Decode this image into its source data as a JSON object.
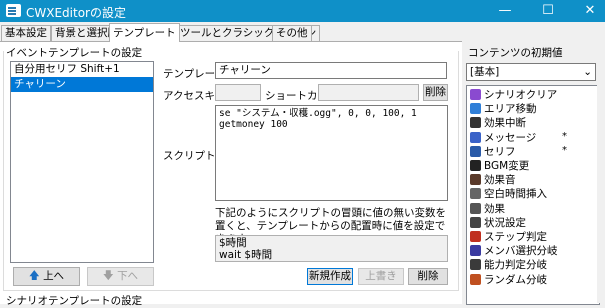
{
  "window": {
    "title": "CWXEditorの設定",
    "minimize": "—",
    "maximize": "☐",
    "close": "✕"
  },
  "tabs": [
    "基本設定",
    "背景と選択肢",
    "テンプレート",
    "外部ツールとクラシックエンジン",
    "その他"
  ],
  "event_templates": {
    "group_title": "イベントテンプレートの設定",
    "items": [
      "自分用セリフ Shift+1",
      "チャリーン"
    ],
    "selected_index": 1,
    "up_button": "上へ",
    "down_button": "下へ"
  },
  "form": {
    "name_label": "テンプレート名",
    "name_value": "チャリーン",
    "accesskey_label": "アクセスキー",
    "accesskey_value": "",
    "shortcut_label": "ショートカット",
    "shortcut_value": "",
    "delete_shortcut": "削除",
    "script_label": "スクリプト",
    "script_lines": [
      "se \"システム・収穫.ogg\", 0, 0, 100, 1",
      "getmoney 100"
    ],
    "help_text": "下記のようにスクリプトの冒頭に値の無い変数を置くと、テンプレートからの配置時に値を設定できます。",
    "example_lines": [
      "$時間",
      "wait $時間"
    ],
    "new_button": "新規作成",
    "overwrite_button": "上書き",
    "delete_button": "削除"
  },
  "scenario_group_title": "シナリオテンプレートの設定",
  "content_panel": {
    "title": "コンテンツの初期値",
    "dropdown_value": "[基本]",
    "items": [
      {
        "label": "シナリオクリア",
        "icon": "scenario-clear-icon",
        "color": "#8a4ad0",
        "star": false
      },
      {
        "label": "エリア移動",
        "icon": "area-move-icon",
        "color": "#2f7fd8",
        "star": false
      },
      {
        "label": "効果中断",
        "icon": "effect-break-icon",
        "color": "#333333",
        "star": false
      },
      {
        "label": "メッセージ",
        "icon": "message-icon",
        "color": "#3a62c8",
        "star": true
      },
      {
        "label": "セリフ",
        "icon": "speech-icon",
        "color": "#2a5aa8",
        "star": true
      },
      {
        "label": "BGM変更",
        "icon": "bgm-icon",
        "color": "#222222",
        "star": false
      },
      {
        "label": "効果音",
        "icon": "sound-effect-icon",
        "color": "#5a3a2a",
        "star": false
      },
      {
        "label": "空白時間挿入",
        "icon": "wait-icon",
        "color": "#666666",
        "star": false
      },
      {
        "label": "効果",
        "icon": "effect-icon",
        "color": "#555555",
        "star": false
      },
      {
        "label": "状況設定",
        "icon": "status-set-icon",
        "color": "#444444",
        "star": false
      },
      {
        "label": "ステップ判定",
        "icon": "step-branch-icon",
        "color": "#c03020",
        "star": false
      },
      {
        "label": "メンバ選択分岐",
        "icon": "member-branch-icon",
        "color": "#3a3aa0",
        "star": false
      },
      {
        "label": "能力判定分岐",
        "icon": "ability-branch-icon",
        "color": "#3a3a3a",
        "star": false
      },
      {
        "label": "ランダム分岐",
        "icon": "random-branch-icon",
        "color": "#c05020",
        "star": false
      }
    ]
  }
}
